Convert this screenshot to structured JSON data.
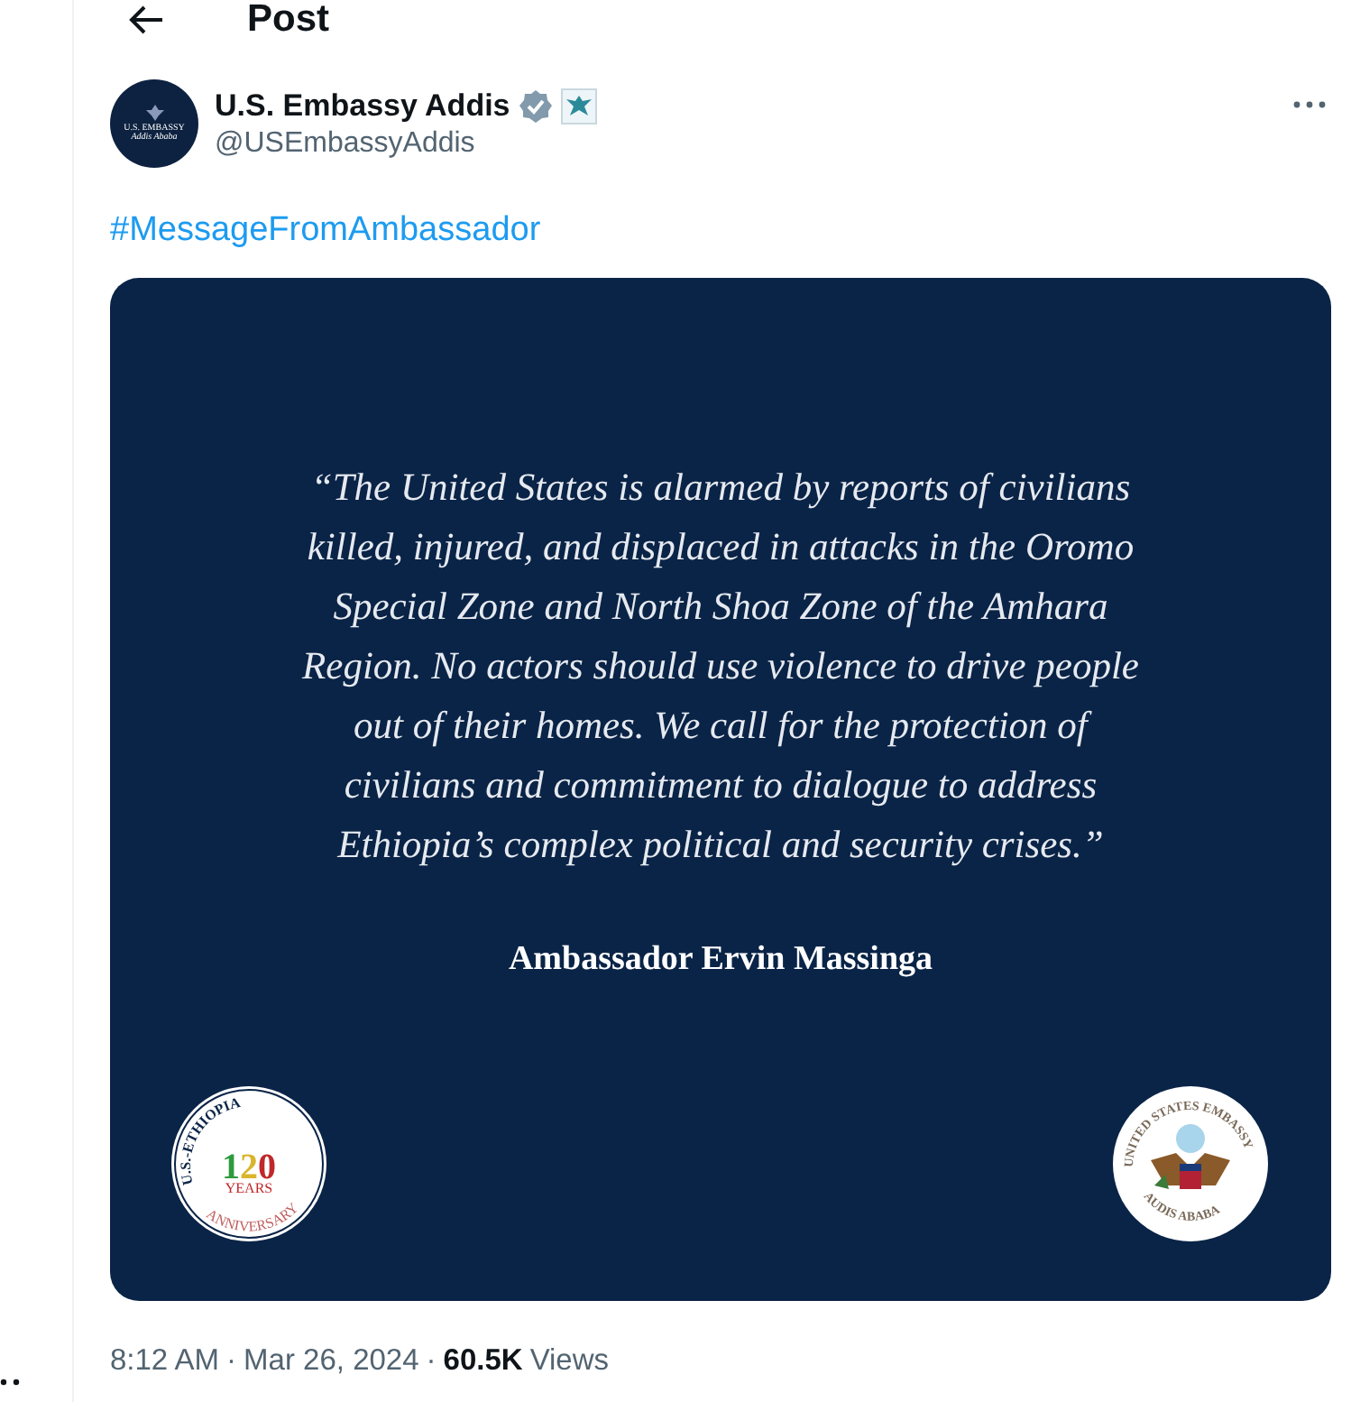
{
  "header": {
    "title": "Post"
  },
  "author": {
    "name": "U.S. Embassy Addis",
    "verified": true,
    "handle": "@USEmbassyAddis",
    "avatar_lines": [
      "U.S. EMBASSY",
      "Addis Ababa"
    ]
  },
  "text": "#MessageFromAmbassador",
  "media": {
    "quote_lines": [
      "“The United States is alarmed by reports of civilians",
      "killed, injured, and displaced in attacks in the Oromo",
      "Special Zone and North Shoa Zone of the Amhara",
      "Region. No actors should use violence to drive people",
      "out of their homes. We call for the protection of",
      "civilians and commitment to dialogue to address",
      "Ethiopia’s complex political and security crises.”"
    ],
    "attribution": "Ambassador Ervin Massinga",
    "left_seal": {
      "top_arc": "U.S.-ETHIOPIA",
      "bottom_arc": "ANNIVERSARY",
      "number": "120",
      "unit": "YEARS"
    },
    "right_seal": {
      "top_arc": "UNITED STATES EMBASSY",
      "bottom_arc": "AUDIS ABABA"
    }
  },
  "meta": {
    "time": "8:12 AM",
    "separator_1": "·",
    "date": "Mar 26, 2024",
    "separator_2": "·",
    "views_count": "60.5K",
    "views_label": "Views"
  }
}
